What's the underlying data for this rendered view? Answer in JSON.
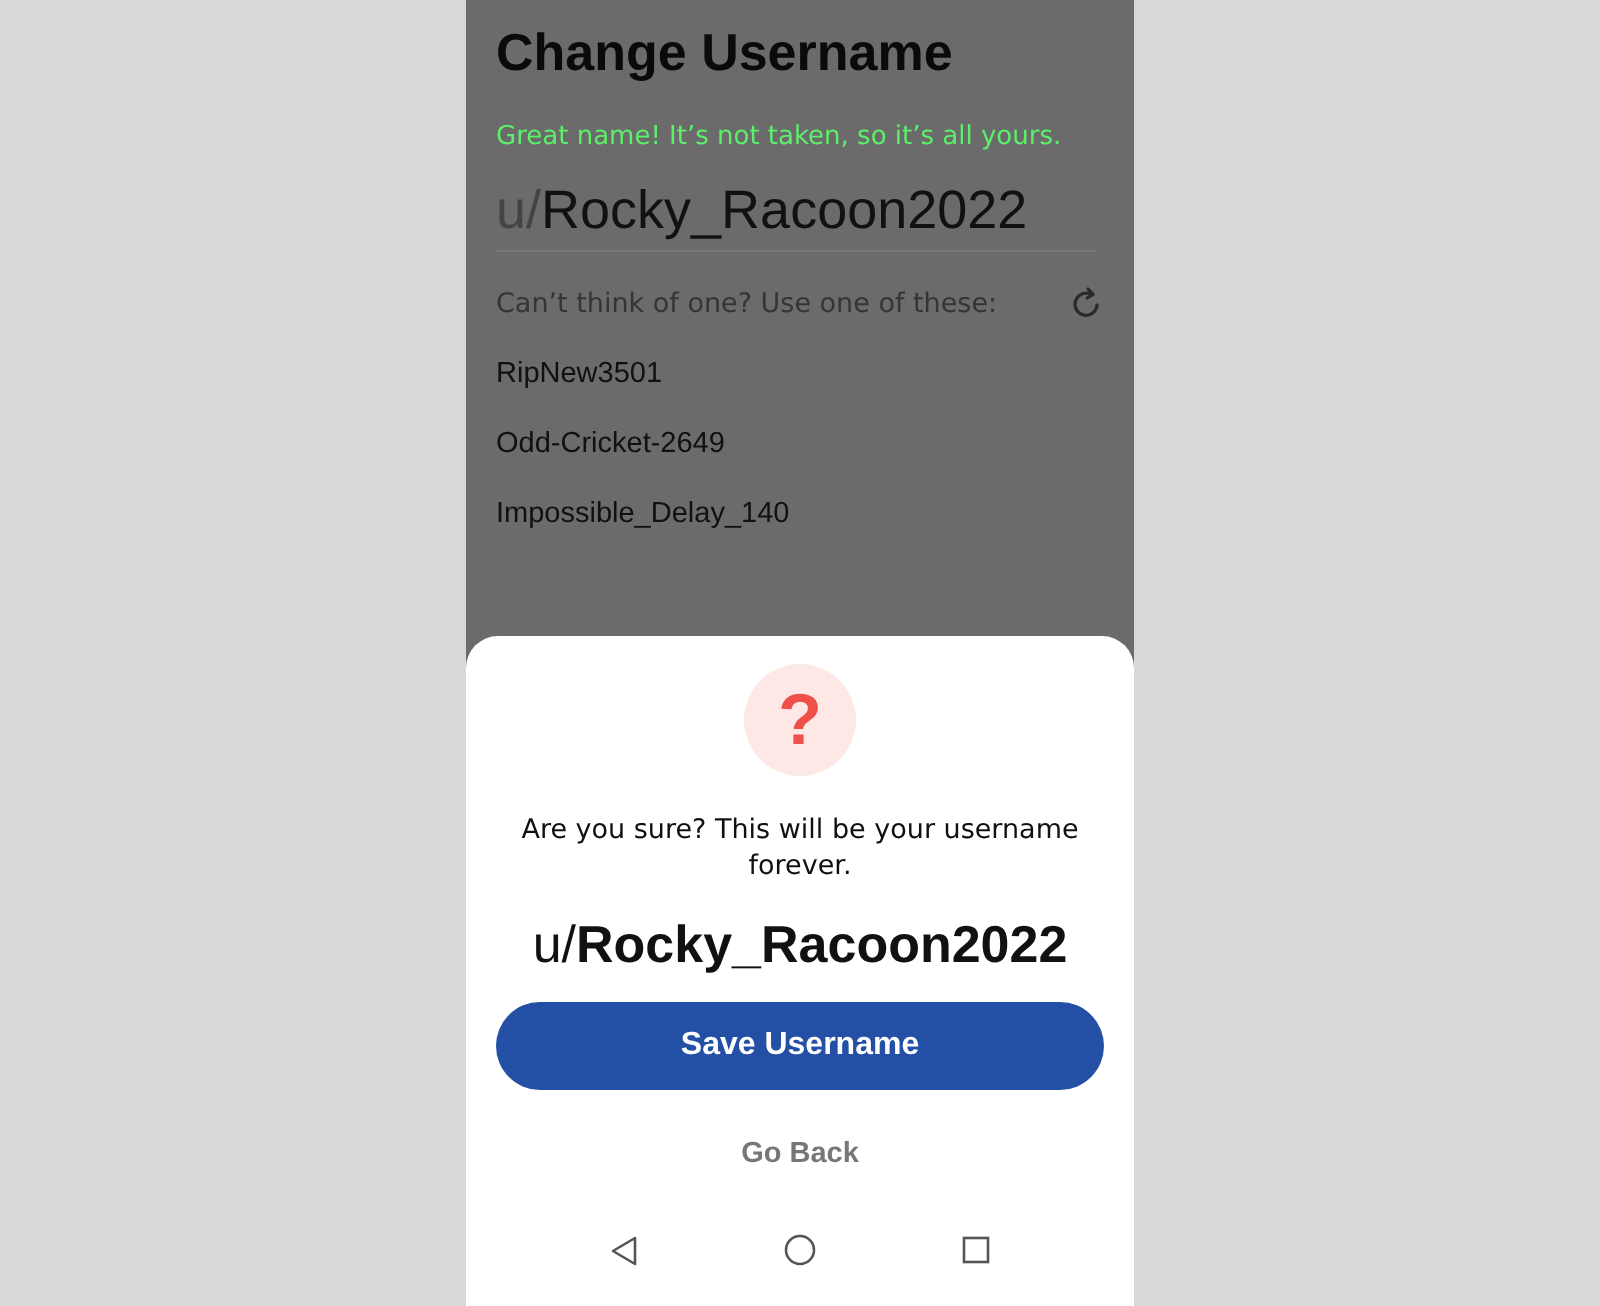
{
  "screen": {
    "title": "Change Username",
    "availability_message": "Great name! It’s not taken, so it’s all yours.",
    "username_field": {
      "prefix": "u/",
      "value": "Rocky_Racoon2022"
    },
    "suggestions_hint": "Can’t think of one? Use one of these:",
    "suggestions": [
      "RipNew3501",
      "Odd-Cricket-2649",
      "Impossible_Delay_140"
    ]
  },
  "dialog": {
    "icon": "?",
    "message": "Are you sure? This will be your username forever.",
    "username": "u/**Rocky_Racoon2022**",
    "buttons": [
      {
        "kind": "primary",
        "label": "Save Username"
      },
      {
        "kind": "text",
        "label": "Go Back"
      }
    ]
  }
}
